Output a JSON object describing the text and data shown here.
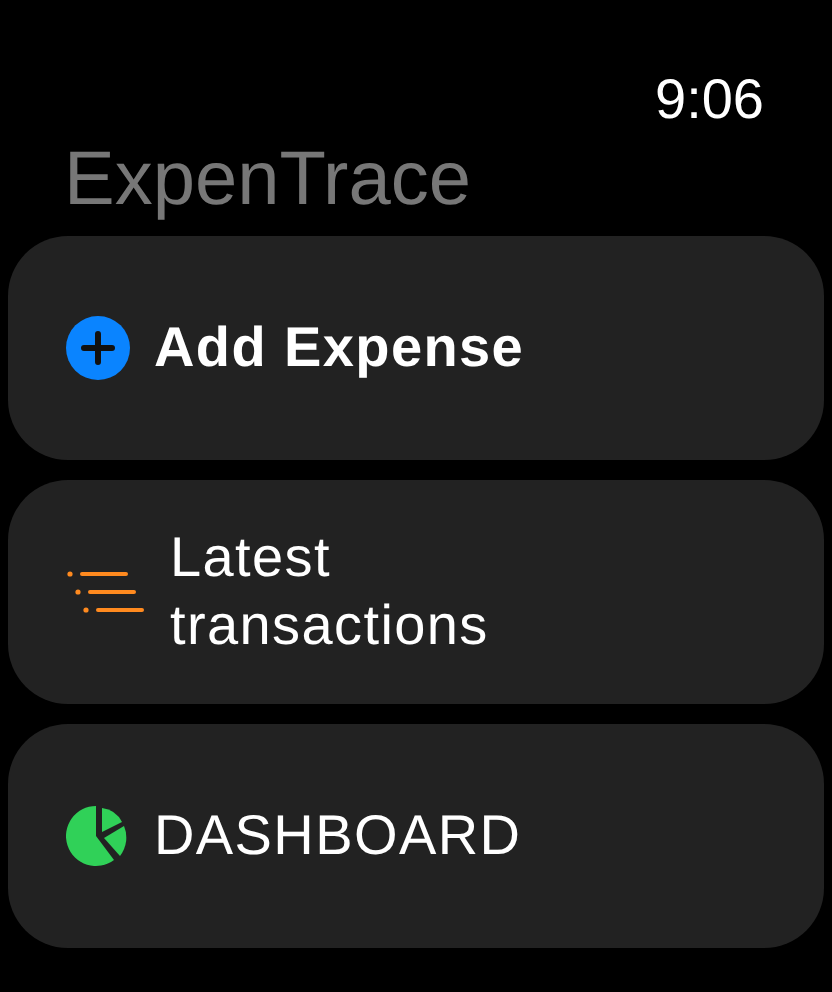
{
  "status_bar": {
    "time": "9:06"
  },
  "app_title": "ExpenTrace",
  "menu": [
    {
      "kind": "add",
      "label": "Add Expense",
      "bold": true
    },
    {
      "kind": "list",
      "label": "Latest transactions",
      "bold": false
    },
    {
      "kind": "chart",
      "label": "DASHBOARD",
      "bold": false
    }
  ]
}
